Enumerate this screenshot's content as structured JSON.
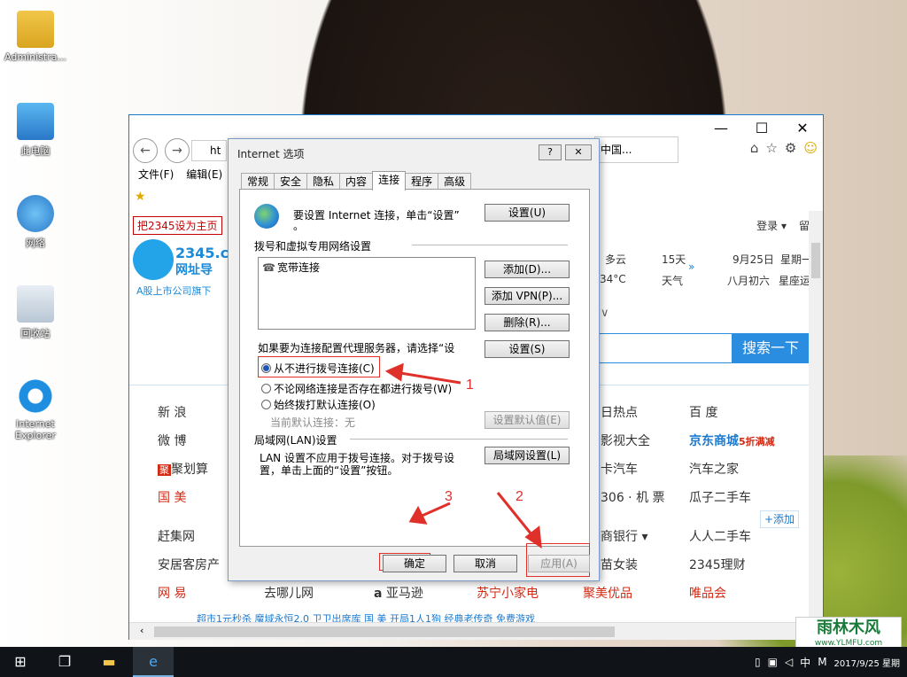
{
  "desktop": {
    "icons": [
      {
        "label": "Administra...",
        "icon": "user-folder-icon"
      },
      {
        "label": "此电脑",
        "icon": "computer-icon"
      },
      {
        "label": "网络",
        "icon": "network-icon"
      },
      {
        "label": "回收站",
        "icon": "recycle-bin-icon"
      },
      {
        "label": "Internet Explorer",
        "icon": "ie-icon"
      }
    ]
  },
  "ie": {
    "address_text": "ht",
    "tab_title": "中国...",
    "menu": [
      "文件(F)",
      "编辑(E)"
    ],
    "page": {
      "set_home": "把2345设为主页",
      "login": "登录 ▾",
      "login2": "留",
      "logo_text": "2345.c",
      "logo_sub_text": "网址导",
      "logo_caption": "A股上市公司旗下",
      "weather": {
        "weather_text": "多云",
        "temp": "34°C",
        "days": "15天",
        "days_label": "天气",
        "date": "9月25日",
        "lunar": "八月初六",
        "weekday": "星期一",
        "constellation": "星座运"
      },
      "search_button": "搜索一下",
      "sites": [
        {
          "text": "新 浪"
        },
        {
          "text": "微 博"
        },
        {
          "text": "聚划算"
        },
        {
          "text": "国 美"
        },
        {
          "text": "赶集网"
        },
        {
          "text": "安居客房产"
        },
        {
          "text": "网 易"
        },
        {
          "text": "去哪儿网"
        },
        {
          "text": "亚马逊"
        },
        {
          "text": "苏宁小家电"
        },
        {
          "text": "聚美优品"
        },
        {
          "text": "唯品会"
        },
        {
          "text": "日热点"
        },
        {
          "text": "影视大全"
        },
        {
          "text": "卡汽车"
        },
        {
          "text": "306 · 机 票"
        },
        {
          "text": "商银行 ▾"
        },
        {
          "text": "苗女装"
        },
        {
          "text": "百 度"
        },
        {
          "text": "京东商城"
        },
        {
          "text": "汽车之家"
        },
        {
          "text": "瓜子二手车"
        },
        {
          "text": "人人二手车"
        },
        {
          "text": "2345理财"
        }
      ],
      "jd_promo": "5折满减",
      "add_button": "+添加",
      "bottom_links": "超市1元秒杀     魔域永恒2.0     卫卫出席库     国 美     开局1人1狗     经典老传奇     免费游戏"
    }
  },
  "dialog": {
    "title": "Internet 选项",
    "help": "?",
    "close": "✕",
    "tabs": [
      "常规",
      "安全",
      "隐私",
      "内容",
      "连接",
      "程序",
      "高级"
    ],
    "active_tab": "连接",
    "setup_text": "要设置 Internet 连接，单击“设置”",
    "setup_text2": "。",
    "setup_button": "设置(U)",
    "dialup_heading": "拨号和虚拟专用网络设置",
    "connections": [
      "宽带连接"
    ],
    "add_button": "添加(D)...",
    "add_vpn_button": "添加 VPN(P)...",
    "remove_button": "删除(R)...",
    "proxy_text": "如果要为连接配置代理服务器，请选择“设",
    "settings_button": "设置(S)",
    "radio_never": "从不进行拨号连接(C)",
    "radio_when_no_network": "不论网络连接是否存在都进行拨号(W)",
    "radio_always": "始终拨打默认连接(O)",
    "current_default_label": "当前默认连接：",
    "current_default_value": "无",
    "set_default_button": "设置默认值(E)",
    "lan_heading": "局域网(LAN)设置",
    "lan_text1": "LAN 设置不应用于拨号连接。对于拨号设",
    "lan_text2": "置，单击上面的“设置”按钮。",
    "lan_button": "局域网设置(L)",
    "ok_button": "确定",
    "cancel_button": "取消",
    "apply_button": "应用(A)",
    "selected_radio": "never"
  },
  "annotations": {
    "n1": "1",
    "n2": "2",
    "n3": "3",
    "color": "#e0302a"
  },
  "watermark": {
    "big": "雨林木风",
    "small": "www.YLMFU.com"
  },
  "taskbar": {
    "tray_lang": "中",
    "tray_letter": "M",
    "clock_partial": "2017/9/25 星期"
  }
}
